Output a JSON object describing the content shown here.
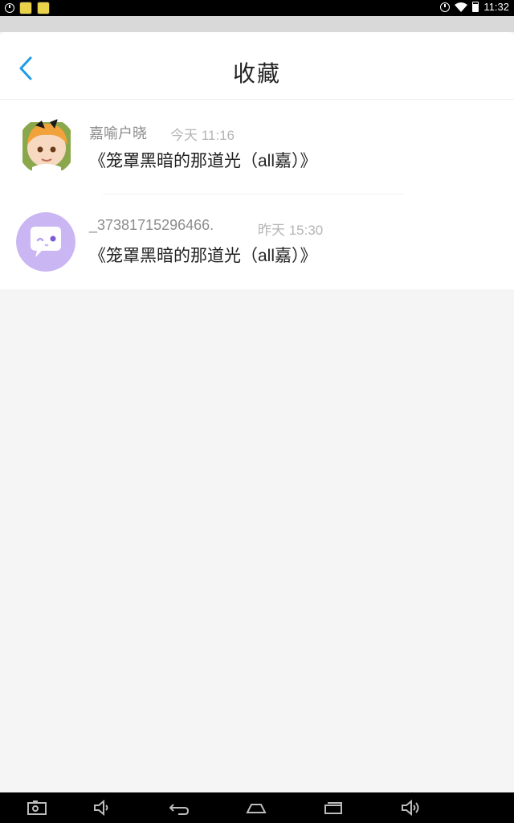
{
  "status_bar": {
    "time": "11:32",
    "icons": [
      "app-icon",
      "app-icon",
      "alarm-icon",
      "wifi-icon",
      "battery-icon"
    ]
  },
  "header": {
    "title": "收藏",
    "back_icon": "chevron-left-icon"
  },
  "items": [
    {
      "name": "嘉喻户晓",
      "time": "今天 11:16",
      "message": "《笼罩黑暗的那道光（all嘉）》",
      "avatar": "anime-character-avatar"
    },
    {
      "name": "_37381715296466.",
      "time": "昨天 15:30",
      "message": "《笼罩黑暗的那道光（all嘉）》",
      "avatar": "chat-bubble-avatar"
    }
  ],
  "nav_bar": {
    "icons": [
      "screenshot-icon",
      "volume-down-icon",
      "back-icon",
      "home-icon",
      "recents-icon",
      "volume-up-icon"
    ]
  },
  "colors": {
    "accent": "#1e9be9",
    "avatar_purple": "#c9b6f2"
  }
}
